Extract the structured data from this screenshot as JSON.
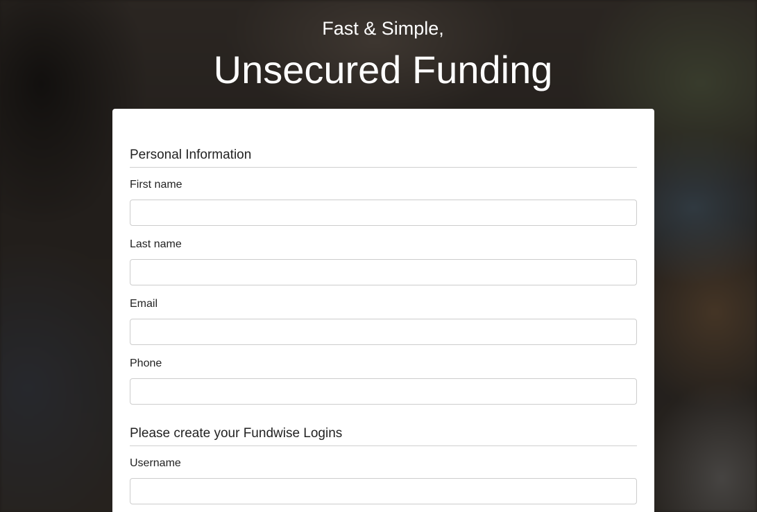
{
  "hero": {
    "subtitle": "Fast & Simple,",
    "title": "Unsecured Funding"
  },
  "form": {
    "personal_section": {
      "title": "Personal Information",
      "fields": {
        "first_name": {
          "label": "First name",
          "value": ""
        },
        "last_name": {
          "label": "Last name",
          "value": ""
        },
        "email": {
          "label": "Email",
          "value": ""
        },
        "phone": {
          "label": "Phone",
          "value": ""
        }
      }
    },
    "logins_section": {
      "title": "Please create your Fundwise Logins",
      "fields": {
        "username": {
          "label": "Username",
          "value": ""
        }
      }
    }
  }
}
